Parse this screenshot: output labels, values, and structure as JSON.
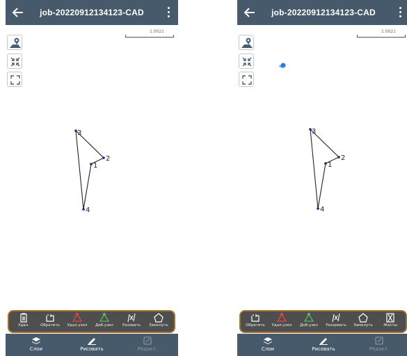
{
  "app": {
    "job_title": "job-20220912134123-CAD",
    "scale_value": "1.0021"
  },
  "colors": {
    "topbar": "#475a6c",
    "toolbar": "#4e4e4e",
    "toolbar_border": "#a3702e",
    "location_dot": "#2a7be4",
    "node_red": "#e0473c",
    "node_green": "#5cb85c"
  },
  "map_controls": [
    {
      "icon": "map-pin-layer-icon"
    },
    {
      "icon": "collapse-arrows-icon"
    },
    {
      "icon": "fullscreen-corners-icon"
    }
  ],
  "polygon_points": [
    "3",
    "2",
    "1",
    "4"
  ],
  "left_screen": {
    "toolbar": [
      {
        "label": "Удал.",
        "icon": "trash-icon"
      },
      {
        "label": "Обратить",
        "icon": "reverse-icon"
      },
      {
        "label": "Удал.узел",
        "icon": "delete-node-icon"
      },
      {
        "label": "Доб.узел",
        "icon": "add-node-icon"
      },
      {
        "label": "Разовать",
        "icon": "split-icon"
      },
      {
        "label": "Замкнуть",
        "icon": "close-polygon-icon"
      }
    ]
  },
  "right_screen": {
    "toolbar": [
      {
        "label": "Обратить",
        "icon": "reverse-icon"
      },
      {
        "label": "Удал.узел",
        "icon": "delete-node-icon"
      },
      {
        "label": "Доб.узел",
        "icon": "add-node-icon"
      },
      {
        "label": "Разорвать",
        "icon": "split-icon"
      },
      {
        "label": "Замкнуть",
        "icon": "close-polygon-icon"
      },
      {
        "label": "Жесты",
        "icon": "hourglass-icon"
      }
    ]
  },
  "bottom_nav": [
    {
      "label": "Слои",
      "icon": "layers-icon"
    },
    {
      "label": "Рисовать",
      "icon": "pencil-icon"
    },
    {
      "label": "Редакт.",
      "icon": "edit-icon",
      "disabled": true
    }
  ]
}
